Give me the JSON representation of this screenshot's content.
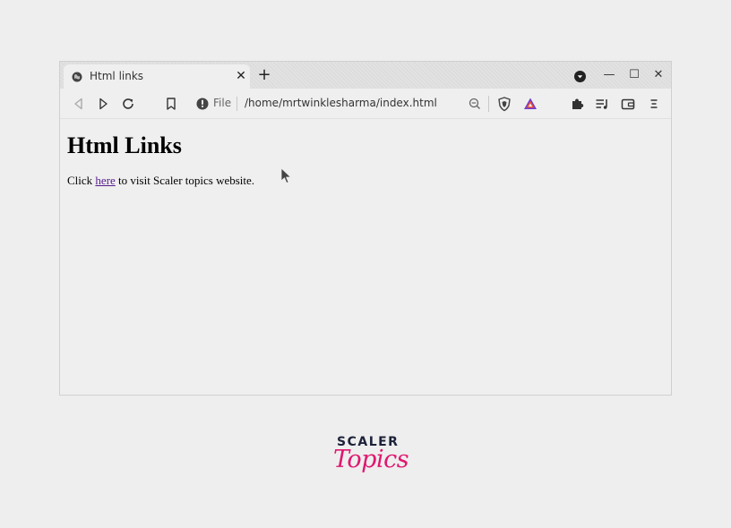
{
  "browser": {
    "tab": {
      "title": "Html links",
      "close_glyph": "✕"
    },
    "new_tab_glyph": "+",
    "window_controls": {
      "minimize_glyph": "—",
      "maximize_glyph": "☐",
      "close_glyph": "✕"
    },
    "address_bar": {
      "scheme_label": "File",
      "url": "/home/mrtwinklesharma/index.html"
    },
    "icons": {
      "tab": "globe-icon",
      "back": "back-arrow-icon",
      "forward": "forward-arrow-icon",
      "reload": "reload-icon",
      "bookmark": "bookmark-icon",
      "site_info": "info-icon",
      "zoom": "zoom-out-icon",
      "shields": "brave-shield-icon",
      "rewards": "brave-rewards-icon",
      "extensions": "puzzle-icon",
      "media": "playlist-icon",
      "wallet": "wallet-icon",
      "menu": "hamburger-menu-icon",
      "profile": "dropdown-circle-icon"
    }
  },
  "page": {
    "heading": "Html Links",
    "para_before": "Click ",
    "link_text": "here",
    "para_after": " to visit Scaler topics website."
  },
  "brand": {
    "line1": "SCALER",
    "line2": "Topics",
    "accent_color": "#e0176f",
    "dark_color": "#1c2238"
  },
  "colors": {
    "link_visited": "#551a8b",
    "background": "#eeeeee"
  }
}
